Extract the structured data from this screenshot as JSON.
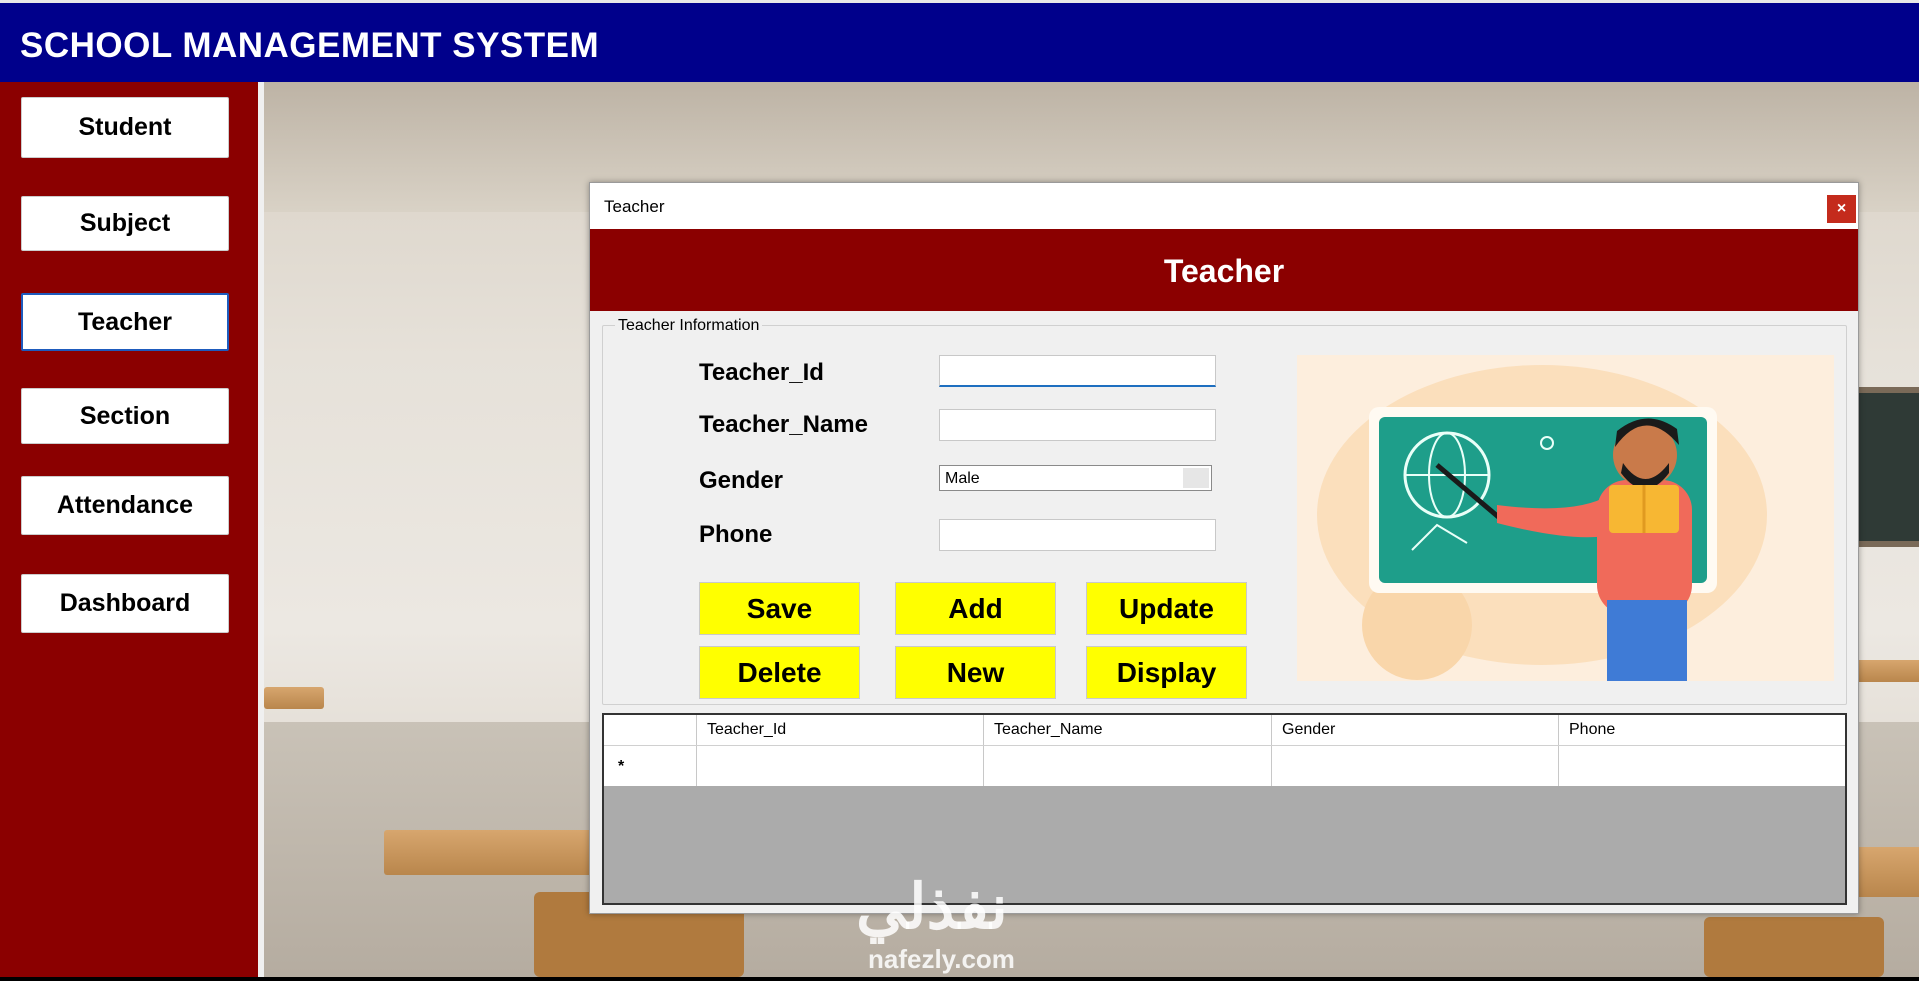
{
  "app": {
    "title": "SCHOOL MANAGEMENT SYSTEM"
  },
  "sidebar": {
    "items": [
      {
        "label": "Student"
      },
      {
        "label": "Subject"
      },
      {
        "label": "Teacher",
        "active": true
      },
      {
        "label": "Section"
      },
      {
        "label": "Attendance"
      },
      {
        "label": "Dashboard"
      }
    ]
  },
  "dialog": {
    "window_title": "Teacher",
    "close_glyph": "×",
    "banner_title": "Teacher",
    "group_title": "Teacher Information",
    "fields": {
      "teacher_id": {
        "label": "Teacher_Id",
        "value": ""
      },
      "teacher_name": {
        "label": "Teacher_Name",
        "value": ""
      },
      "gender": {
        "label": "Gender",
        "value": "Male"
      },
      "phone": {
        "label": "Phone",
        "value": ""
      }
    },
    "buttons": {
      "save": "Save",
      "add": "Add",
      "update": "Update",
      "delete": "Delete",
      "new": "New",
      "display": "Display"
    },
    "grid": {
      "columns": [
        "Teacher_Id",
        "Teacher_Name",
        "Gender",
        "Phone"
      ],
      "new_row_marker": "*"
    }
  },
  "watermark": {
    "text": "نفذلي",
    "sub": "nafezly.com"
  },
  "colors": {
    "titlebar": "#00008b",
    "sidebar": "#8b0000",
    "banner": "#8b0000",
    "action_button": "#ffff00",
    "close_button": "#c42b1c"
  }
}
